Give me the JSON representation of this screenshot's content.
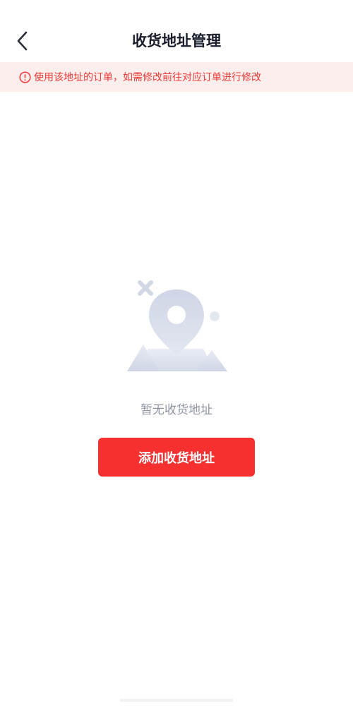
{
  "header": {
    "title": "收货地址管理",
    "back_icon": "chevron-left-icon"
  },
  "notice": {
    "icon": "info-circle-icon",
    "text": "使用该地址的订单，如需修改前往对应订单进行修改",
    "color": "#ee3a36",
    "background": "#fdeeee"
  },
  "empty_state": {
    "illustration": "location-pin-illustration",
    "message": "暂无收货地址"
  },
  "actions": {
    "add_label": "添加收货地址",
    "add_color": "#f6302f"
  }
}
